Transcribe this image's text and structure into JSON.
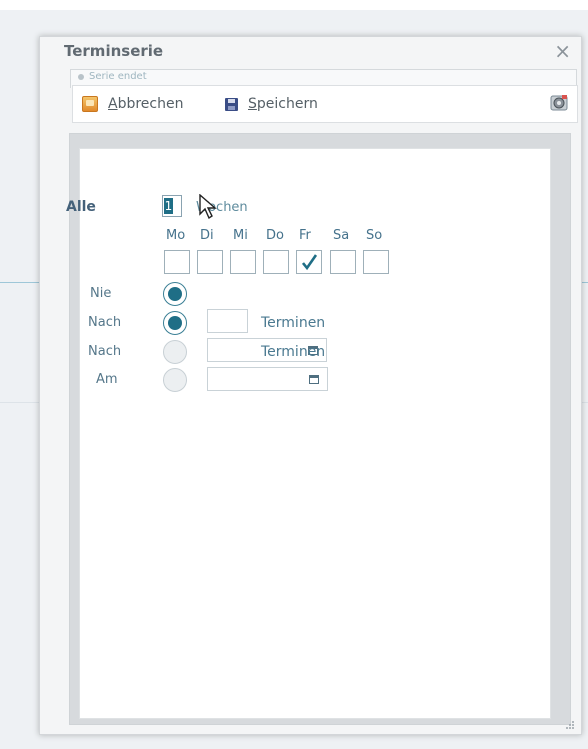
{
  "dialog": {
    "title": "Terminserie",
    "close_glyph": "×",
    "ghost_label": "Serie endet"
  },
  "toolbar": {
    "cancel_label_u": "A",
    "cancel_label_rest": "bbrechen",
    "save_label_u": "S",
    "save_label_rest": "peichern"
  },
  "form": {
    "alle_label": "Alle",
    "interval_value": "1",
    "interval_unit": "Wochen",
    "days": [
      {
        "label": "Mo",
        "checked": false
      },
      {
        "label": "Di",
        "checked": false
      },
      {
        "label": "Mi",
        "checked": false
      },
      {
        "label": "Do",
        "checked": false
      },
      {
        "label": "Fr",
        "checked": true
      },
      {
        "label": "Sa",
        "checked": false
      },
      {
        "label": "So",
        "checked": false
      }
    ],
    "end_options": {
      "nie": {
        "label": "Nie",
        "selected": true
      },
      "nach": {
        "label": "Nach",
        "selected": true,
        "unit": "Terminen",
        "value": ""
      },
      "nach2": {
        "label": "Nach",
        "selected": false,
        "unit": "Terminen",
        "value": ""
      },
      "am": {
        "label": "Am",
        "selected": false,
        "value": ""
      }
    }
  },
  "colors": {
    "accent": "#1f6e86",
    "label": "#55778a"
  },
  "icons": [
    "cancel-icon",
    "save-icon",
    "settings-icon",
    "close-icon",
    "calendar-icon",
    "checkmark-icon",
    "mouse-cursor-icon"
  ]
}
